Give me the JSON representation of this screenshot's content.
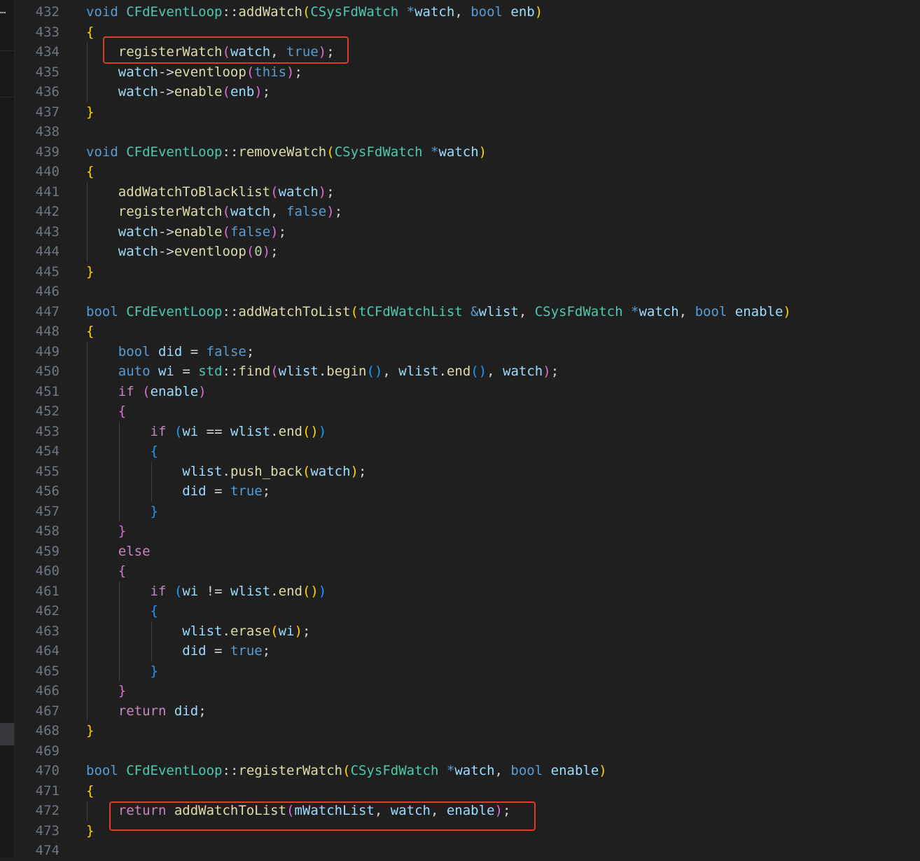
{
  "editor": {
    "line_numbers": [
      "432",
      "433",
      "434",
      "435",
      "436",
      "437",
      "438",
      "439",
      "440",
      "441",
      "442",
      "443",
      "444",
      "445",
      "446",
      "447",
      "448",
      "449",
      "450",
      "451",
      "452",
      "453",
      "454",
      "455",
      "456",
      "457",
      "458",
      "459",
      "460",
      "461",
      "462",
      "463",
      "464",
      "465",
      "466",
      "467",
      "468",
      "469",
      "470",
      "471",
      "472",
      "473",
      "474"
    ],
    "lines": [
      [
        [
          "kw",
          "void"
        ],
        [
          "pu",
          " "
        ],
        [
          "ty",
          "CFdEventLoop"
        ],
        [
          "pu",
          "::"
        ],
        [
          "fn",
          "addWatch"
        ],
        [
          "b1",
          "("
        ],
        [
          "ty",
          "CSysFdWatch"
        ],
        [
          "pu",
          " "
        ],
        [
          "kw",
          "*"
        ],
        [
          "va",
          "watch"
        ],
        [
          "pu",
          ", "
        ],
        [
          "kw",
          "bool"
        ],
        [
          "pu",
          " "
        ],
        [
          "va",
          "enb"
        ],
        [
          "b1",
          ")"
        ]
      ],
      [
        [
          "b1",
          "{"
        ]
      ],
      [
        [
          "pu",
          "    "
        ],
        [
          "fn",
          "registerWatch"
        ],
        [
          "b2",
          "("
        ],
        [
          "va",
          "watch"
        ],
        [
          "pu",
          ", "
        ],
        [
          "kw",
          "true"
        ],
        [
          "b2",
          ")"
        ],
        [
          "pu",
          ";"
        ]
      ],
      [
        [
          "pu",
          "    "
        ],
        [
          "va",
          "watch"
        ],
        [
          "pu",
          "->"
        ],
        [
          "fn",
          "eventloop"
        ],
        [
          "b2",
          "("
        ],
        [
          "kw",
          "this"
        ],
        [
          "b2",
          ")"
        ],
        [
          "pu",
          ";"
        ]
      ],
      [
        [
          "pu",
          "    "
        ],
        [
          "va",
          "watch"
        ],
        [
          "pu",
          "->"
        ],
        [
          "fn",
          "enable"
        ],
        [
          "b2",
          "("
        ],
        [
          "va",
          "enb"
        ],
        [
          "b2",
          ")"
        ],
        [
          "pu",
          ";"
        ]
      ],
      [
        [
          "b1",
          "}"
        ]
      ],
      [],
      [
        [
          "kw",
          "void"
        ],
        [
          "pu",
          " "
        ],
        [
          "ty",
          "CFdEventLoop"
        ],
        [
          "pu",
          "::"
        ],
        [
          "fn",
          "removeWatch"
        ],
        [
          "b1",
          "("
        ],
        [
          "ty",
          "CSysFdWatch"
        ],
        [
          "pu",
          " "
        ],
        [
          "kw",
          "*"
        ],
        [
          "va",
          "watch"
        ],
        [
          "b1",
          ")"
        ]
      ],
      [
        [
          "b1",
          "{"
        ]
      ],
      [
        [
          "pu",
          "    "
        ],
        [
          "fn",
          "addWatchToBlacklist"
        ],
        [
          "b2",
          "("
        ],
        [
          "va",
          "watch"
        ],
        [
          "b2",
          ")"
        ],
        [
          "pu",
          ";"
        ]
      ],
      [
        [
          "pu",
          "    "
        ],
        [
          "fn",
          "registerWatch"
        ],
        [
          "b2",
          "("
        ],
        [
          "va",
          "watch"
        ],
        [
          "pu",
          ", "
        ],
        [
          "kw",
          "false"
        ],
        [
          "b2",
          ")"
        ],
        [
          "pu",
          ";"
        ]
      ],
      [
        [
          "pu",
          "    "
        ],
        [
          "va",
          "watch"
        ],
        [
          "pu",
          "->"
        ],
        [
          "fn",
          "enable"
        ],
        [
          "b2",
          "("
        ],
        [
          "kw",
          "false"
        ],
        [
          "b2",
          ")"
        ],
        [
          "pu",
          ";"
        ]
      ],
      [
        [
          "pu",
          "    "
        ],
        [
          "va",
          "watch"
        ],
        [
          "pu",
          "->"
        ],
        [
          "fn",
          "eventloop"
        ],
        [
          "b2",
          "("
        ],
        [
          "nu",
          "0"
        ],
        [
          "b2",
          ")"
        ],
        [
          "pu",
          ";"
        ]
      ],
      [
        [
          "b1",
          "}"
        ]
      ],
      [],
      [
        [
          "kw",
          "bool"
        ],
        [
          "pu",
          " "
        ],
        [
          "ty",
          "CFdEventLoop"
        ],
        [
          "pu",
          "::"
        ],
        [
          "fn",
          "addWatchToList"
        ],
        [
          "b1",
          "("
        ],
        [
          "ty",
          "tCFdWatchList"
        ],
        [
          "pu",
          " "
        ],
        [
          "kw",
          "&"
        ],
        [
          "va",
          "wlist"
        ],
        [
          "pu",
          ", "
        ],
        [
          "ty",
          "CSysFdWatch"
        ],
        [
          "pu",
          " "
        ],
        [
          "kw",
          "*"
        ],
        [
          "va",
          "watch"
        ],
        [
          "pu",
          ", "
        ],
        [
          "kw",
          "bool"
        ],
        [
          "pu",
          " "
        ],
        [
          "va",
          "enable"
        ],
        [
          "b1",
          ")"
        ]
      ],
      [
        [
          "b1",
          "{"
        ]
      ],
      [
        [
          "pu",
          "    "
        ],
        [
          "kw",
          "bool"
        ],
        [
          "pu",
          " "
        ],
        [
          "va",
          "did"
        ],
        [
          "pu",
          " = "
        ],
        [
          "kw",
          "false"
        ],
        [
          "pu",
          ";"
        ]
      ],
      [
        [
          "pu",
          "    "
        ],
        [
          "kw",
          "auto"
        ],
        [
          "pu",
          " "
        ],
        [
          "va",
          "wi"
        ],
        [
          "pu",
          " = "
        ],
        [
          "ty",
          "std"
        ],
        [
          "pu",
          "::"
        ],
        [
          "fn",
          "find"
        ],
        [
          "b2",
          "("
        ],
        [
          "va",
          "wlist"
        ],
        [
          "pu",
          "."
        ],
        [
          "fn",
          "begin"
        ],
        [
          "b3",
          "()"
        ],
        [
          "pu",
          ", "
        ],
        [
          "va",
          "wlist"
        ],
        [
          "pu",
          "."
        ],
        [
          "fn",
          "end"
        ],
        [
          "b3",
          "()"
        ],
        [
          "pu",
          ", "
        ],
        [
          "va",
          "watch"
        ],
        [
          "b2",
          ")"
        ],
        [
          "pu",
          ";"
        ]
      ],
      [
        [
          "pu",
          "    "
        ],
        [
          "kwc",
          "if"
        ],
        [
          "pu",
          " "
        ],
        [
          "b2",
          "("
        ],
        [
          "va",
          "enable"
        ],
        [
          "b2",
          ")"
        ]
      ],
      [
        [
          "pu",
          "    "
        ],
        [
          "b2",
          "{"
        ]
      ],
      [
        [
          "pu",
          "        "
        ],
        [
          "kwc",
          "if"
        ],
        [
          "pu",
          " "
        ],
        [
          "b3",
          "("
        ],
        [
          "va",
          "wi"
        ],
        [
          "pu",
          " == "
        ],
        [
          "va",
          "wlist"
        ],
        [
          "pu",
          "."
        ],
        [
          "fn",
          "end"
        ],
        [
          "b1",
          "()"
        ],
        [
          "b3",
          ")"
        ]
      ],
      [
        [
          "pu",
          "        "
        ],
        [
          "b3",
          "{"
        ]
      ],
      [
        [
          "pu",
          "            "
        ],
        [
          "va",
          "wlist"
        ],
        [
          "pu",
          "."
        ],
        [
          "fn",
          "push_back"
        ],
        [
          "b1",
          "("
        ],
        [
          "va",
          "watch"
        ],
        [
          "b1",
          ")"
        ],
        [
          "pu",
          ";"
        ]
      ],
      [
        [
          "pu",
          "            "
        ],
        [
          "va",
          "did"
        ],
        [
          "pu",
          " = "
        ],
        [
          "kw",
          "true"
        ],
        [
          "pu",
          ";"
        ]
      ],
      [
        [
          "pu",
          "        "
        ],
        [
          "b3",
          "}"
        ]
      ],
      [
        [
          "pu",
          "    "
        ],
        [
          "b2",
          "}"
        ]
      ],
      [
        [
          "pu",
          "    "
        ],
        [
          "kwc",
          "else"
        ]
      ],
      [
        [
          "pu",
          "    "
        ],
        [
          "b2",
          "{"
        ]
      ],
      [
        [
          "pu",
          "        "
        ],
        [
          "kwc",
          "if"
        ],
        [
          "pu",
          " "
        ],
        [
          "b3",
          "("
        ],
        [
          "va",
          "wi"
        ],
        [
          "pu",
          " != "
        ],
        [
          "va",
          "wlist"
        ],
        [
          "pu",
          "."
        ],
        [
          "fn",
          "end"
        ],
        [
          "b1",
          "()"
        ],
        [
          "b3",
          ")"
        ]
      ],
      [
        [
          "pu",
          "        "
        ],
        [
          "b3",
          "{"
        ]
      ],
      [
        [
          "pu",
          "            "
        ],
        [
          "va",
          "wlist"
        ],
        [
          "pu",
          "."
        ],
        [
          "fn",
          "erase"
        ],
        [
          "b1",
          "("
        ],
        [
          "va",
          "wi"
        ],
        [
          "b1",
          ")"
        ],
        [
          "pu",
          ";"
        ]
      ],
      [
        [
          "pu",
          "            "
        ],
        [
          "va",
          "did"
        ],
        [
          "pu",
          " = "
        ],
        [
          "kw",
          "true"
        ],
        [
          "pu",
          ";"
        ]
      ],
      [
        [
          "pu",
          "        "
        ],
        [
          "b3",
          "}"
        ]
      ],
      [
        [
          "pu",
          "    "
        ],
        [
          "b2",
          "}"
        ]
      ],
      [
        [
          "pu",
          "    "
        ],
        [
          "kwc",
          "return"
        ],
        [
          "pu",
          " "
        ],
        [
          "va",
          "did"
        ],
        [
          "pu",
          ";"
        ]
      ],
      [
        [
          "b1",
          "}"
        ]
      ],
      [],
      [
        [
          "kw",
          "bool"
        ],
        [
          "pu",
          " "
        ],
        [
          "ty",
          "CFdEventLoop"
        ],
        [
          "pu",
          "::"
        ],
        [
          "fn",
          "registerWatch"
        ],
        [
          "b1",
          "("
        ],
        [
          "ty",
          "CSysFdWatch"
        ],
        [
          "pu",
          " "
        ],
        [
          "kw",
          "*"
        ],
        [
          "va",
          "watch"
        ],
        [
          "pu",
          ", "
        ],
        [
          "kw",
          "bool"
        ],
        [
          "pu",
          " "
        ],
        [
          "va",
          "enable"
        ],
        [
          "b1",
          ")"
        ]
      ],
      [
        [
          "b1",
          "{"
        ]
      ],
      [
        [
          "pu",
          "    "
        ],
        [
          "kwc",
          "return"
        ],
        [
          "pu",
          " "
        ],
        [
          "fn",
          "addWatchToList"
        ],
        [
          "b2",
          "("
        ],
        [
          "va",
          "mWatchList"
        ],
        [
          "pu",
          ", "
        ],
        [
          "va",
          "watch"
        ],
        [
          "pu",
          ", "
        ],
        [
          "va",
          "enable"
        ],
        [
          "b2",
          ")"
        ],
        [
          "pu",
          ";"
        ]
      ],
      [
        [
          "b1",
          "}"
        ]
      ],
      []
    ]
  },
  "sidebar": {
    "overflow_glyph": "…"
  },
  "highlights": [
    {
      "label": "registerWatch-call-box"
    },
    {
      "label": "return-addWatchToList-box"
    }
  ]
}
